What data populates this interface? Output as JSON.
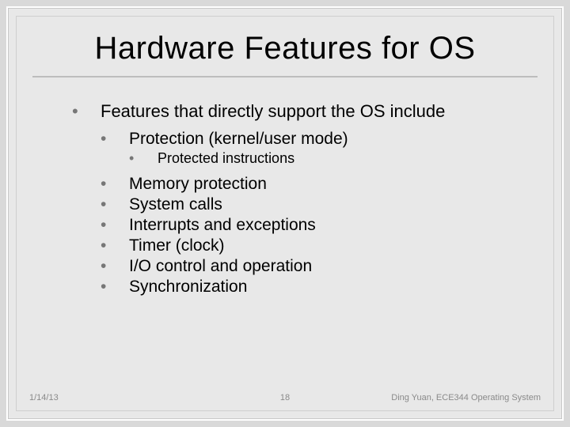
{
  "title": "Hardware Features for OS",
  "bullets": {
    "main": "Features that directly support the OS include",
    "sub0": "Protection (kernel/user mode)",
    "sub0a": "Protected instructions",
    "items": [
      "Memory protection",
      "System calls",
      "Interrupts and exceptions",
      "Timer (clock)",
      "I/O control and operation",
      "Synchronization"
    ]
  },
  "footer": {
    "date": "1/14/13",
    "page": "18",
    "attribution": "Ding Yuan, ECE344 Operating System"
  }
}
